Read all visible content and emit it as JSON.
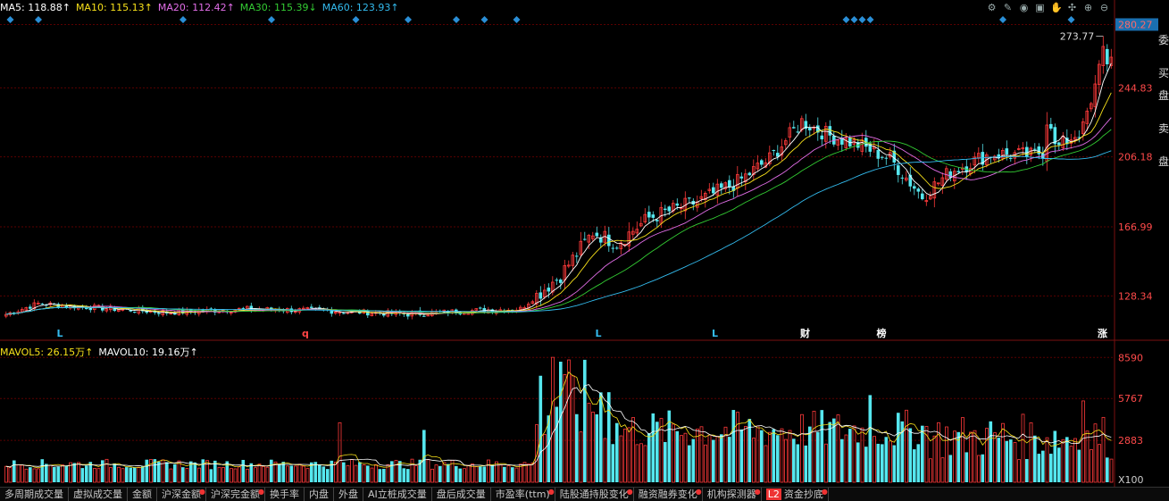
{
  "ma_header": {
    "items": [
      {
        "text": "MA5: 118.88↑",
        "color": "#ffffff"
      },
      {
        "text": "MA10: 115.13↑",
        "color": "#f7e01a"
      },
      {
        "text": "MA20: 112.42↑",
        "color": "#e26ee8"
      },
      {
        "text": "MA30: 115.39↓",
        "color": "#33cc33"
      },
      {
        "text": "MA60: 123.93↑",
        "color": "#33bbee"
      }
    ]
  },
  "vol_header": {
    "items": [
      {
        "text": "MAVOL5: 26.15万↑",
        "color": "#f7e01a"
      },
      {
        "text": "MAVOL10: 19.16万↑",
        "color": "#ffffff"
      }
    ]
  },
  "toolbar": {
    "icons": [
      "settings-icon",
      "brush-icon",
      "eye-icon",
      "bag-icon",
      "hand-icon",
      "drag-icon",
      "zoom-in-icon",
      "zoom-out-icon"
    ],
    "glyphs": [
      "⚙",
      "✎",
      "◉",
      "▣",
      "✋",
      "✣",
      "⊕",
      "⊖"
    ]
  },
  "price_axis": {
    "labels": [
      "280.27",
      "244.83",
      "206.18",
      "166.99",
      "128.34"
    ],
    "current_price_label": "280.27",
    "current_color": "#1a6fb0"
  },
  "volume_axis": {
    "labels": [
      "8590",
      "5767",
      "2883"
    ],
    "unit": "X100"
  },
  "annotations": {
    "high_label": "273.77"
  },
  "events": [
    {
      "label": "L",
      "color": "#33bbee",
      "index": 13
    },
    {
      "label": "q",
      "color": "#ff4444",
      "index": 74
    },
    {
      "label": "L",
      "color": "#33bbee",
      "index": 147
    },
    {
      "label": "L",
      "color": "#33bbee",
      "index": 176
    },
    {
      "label": "财",
      "color": "#ffffff",
      "index": 198
    },
    {
      "label": "榜",
      "color": "#ffffff",
      "index": 217
    },
    {
      "label": "涨",
      "color": "#ffffff",
      "index": 272
    }
  ],
  "tabs": [
    {
      "label": "多周期成交量",
      "dot": false
    },
    {
      "label": "虚拟成交量",
      "dot": false
    },
    {
      "label": "金额",
      "dot": false
    },
    {
      "label": "沪深金额",
      "dot": true
    },
    {
      "label": "沪深完金额",
      "dot": true
    },
    {
      "label": "换手率",
      "dot": false
    },
    {
      "label": "内盘",
      "dot": false
    },
    {
      "label": "外盘",
      "dot": false
    },
    {
      "label": "AI立桩成交量",
      "dot": false
    },
    {
      "label": "盘后成交量",
      "dot": false
    },
    {
      "label": "市盈率(ttm)",
      "dot": true
    },
    {
      "label": "陆股通持股变化",
      "dot": true
    },
    {
      "label": "融资融券变化",
      "dot": true
    },
    {
      "label": "机构探测器",
      "dot": true
    },
    {
      "label": "资金抄底",
      "dot": true,
      "l2": "L2"
    }
  ],
  "right_strip": [
    "委",
    "买",
    "盘",
    "卖",
    "盘"
  ],
  "colors": {
    "up": "#ff3a3a",
    "down": "#55e6ee",
    "grid": "#5a0000",
    "axis_text": "#ff4a4a",
    "marker": "#2a8ed6"
  },
  "chart_data": {
    "type": "candlestick",
    "y_range": [
      105,
      283
    ],
    "vol_range": [
      0,
      9100
    ],
    "candles": [],
    "ma_series": [
      {
        "name": "MA5",
        "color": "#ffffff"
      },
      {
        "name": "MA10",
        "color": "#f7e01a"
      },
      {
        "name": "MA20",
        "color": "#e26ee8"
      },
      {
        "name": "MA30",
        "color": "#33cc33"
      },
      {
        "name": "MA60",
        "color": "#33bbee"
      }
    ]
  }
}
